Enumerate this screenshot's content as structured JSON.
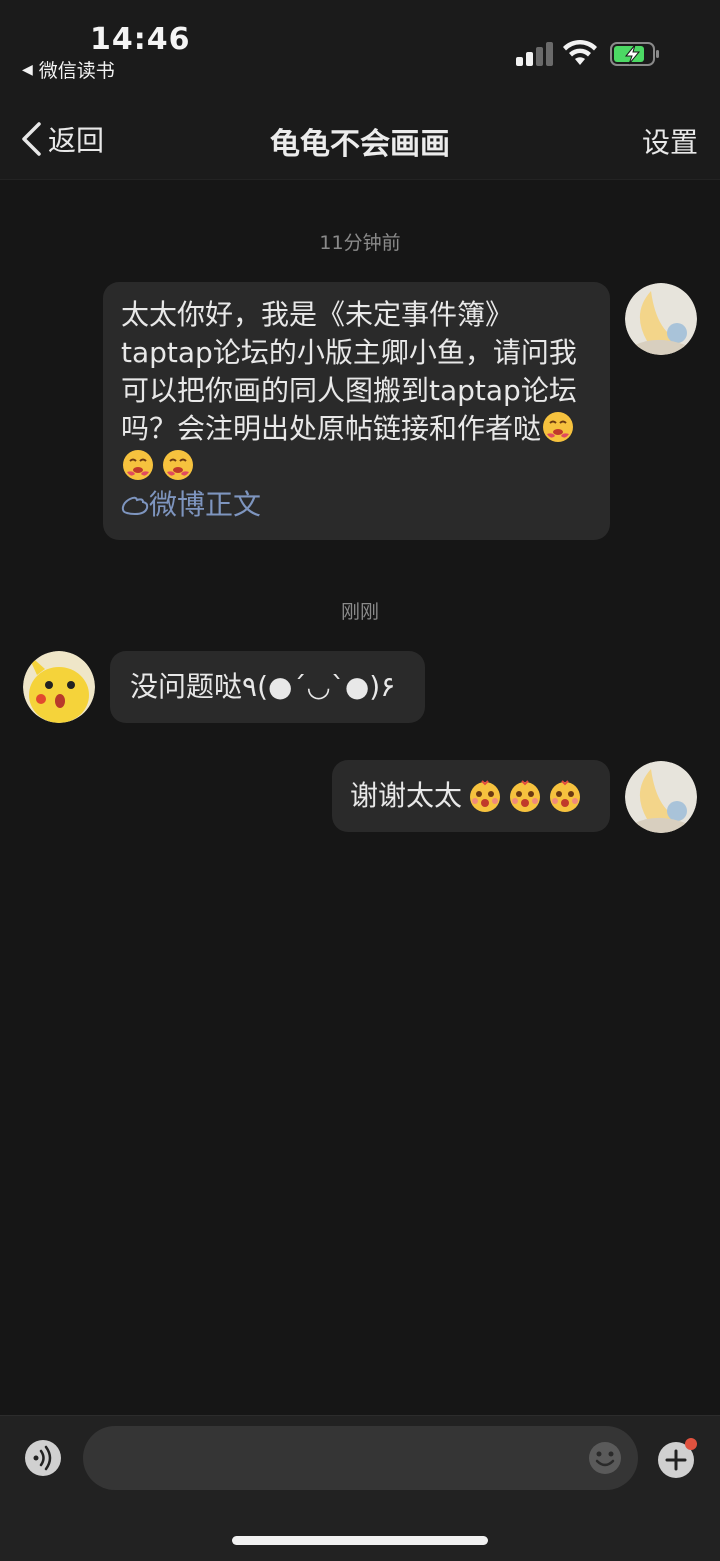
{
  "status_bar": {
    "time": "14:46",
    "back_app": "微信读书",
    "back_icon": "back-triangle-icon",
    "signal_icon": "cellular-signal-icon",
    "wifi_icon": "wifi-icon",
    "battery_icon": "battery-charging-icon"
  },
  "nav": {
    "back_label": "返回",
    "title": "龟龟不会画画",
    "settings_label": "设置"
  },
  "messages": [
    {
      "timestamp": "11分钟前",
      "side": "right",
      "avatar": "moon-avatar",
      "text": "太太你好，我是《未定事件簿》taptap论坛的小版主卿小鱼，请问我可以把你画的同人图搬到taptap论坛吗？会注明出处原帖链接和作者哒",
      "emojis": [
        "drooling-emoji",
        "drooling-emoji",
        "drooling-emoji"
      ],
      "link_label": "微博正文"
    },
    {
      "timestamp": "刚刚",
      "side": "left",
      "avatar": "pikachu-avatar",
      "text": "没问题哒٩(●´◡`●)۶"
    },
    {
      "side": "right",
      "avatar": "moon-avatar",
      "text": "谢谢太太",
      "emojis": [
        "excited-emoji",
        "excited-emoji",
        "excited-emoji"
      ]
    }
  ],
  "input_bar": {
    "voice_icon": "voice-icon",
    "input_value": "",
    "emoji_icon": "emoji-icon",
    "plus_icon": "plus-icon",
    "notification_dot_color": "#e0523f"
  },
  "colors": {
    "background": "#161616",
    "bubble": "#2a2a2a",
    "link": "#7e95bf"
  }
}
